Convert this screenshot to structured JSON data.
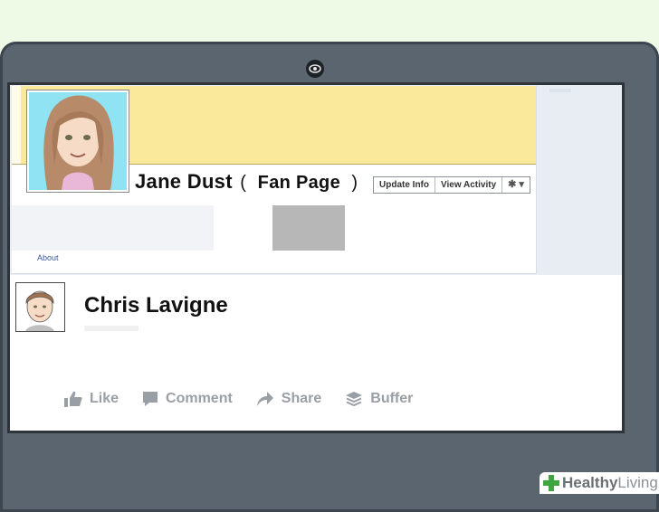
{
  "page": {
    "name": "Jane Dust",
    "paren_open": "(",
    "fan_label": "Fan Page",
    "paren_close": ")"
  },
  "toolbar": {
    "update_info": "Update Info",
    "view_activity": "View Activity",
    "gear_glyph": "✱",
    "caret_glyph": "▾"
  },
  "nav": {
    "about": "About"
  },
  "post": {
    "author": "Chris Lavigne",
    "actions": {
      "like": "Like",
      "comment": "Comment",
      "share": "Share",
      "buffer": "Buffer"
    }
  },
  "brand": {
    "bold": "Healthy",
    "light": "Living"
  },
  "colors": {
    "cover": "#fbe99b",
    "laptop_frame": "#5b6570",
    "background": "#eefae6",
    "action_grey": "#9a9fa6",
    "brand_green": "#3fa63f"
  }
}
